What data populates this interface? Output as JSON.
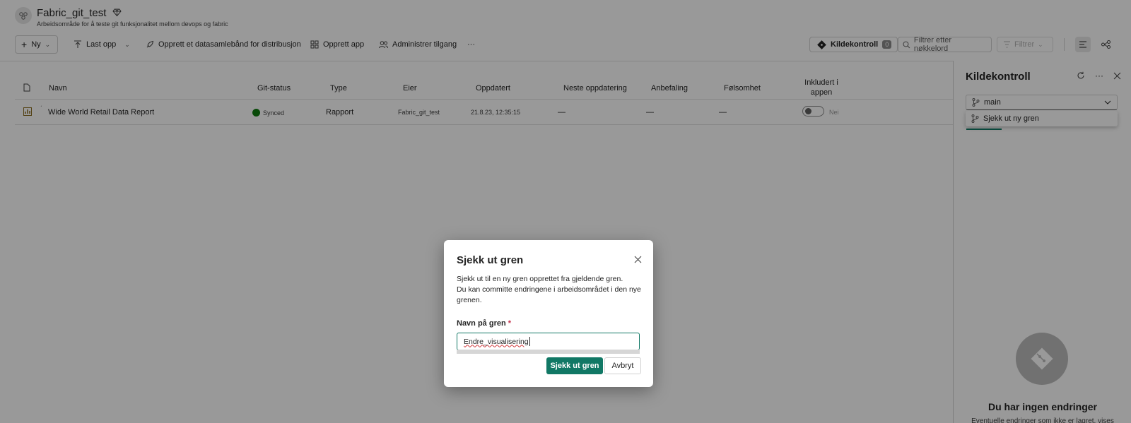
{
  "workspace": {
    "title": "Fabric_git_test",
    "subtitle": "Arbeidsområde for å teste git funksjonalitet mellom devops og fabric"
  },
  "toolbar": {
    "new_label": "Ny",
    "upload_label": "Last opp",
    "pipeline_label": "Opprett et datasamlebånd for distribusjon",
    "create_app_label": "Opprett app",
    "manage_access_label": "Administrer tilgang",
    "more_label": "···",
    "source_control_label": "Kildekontroll",
    "source_control_count": "0",
    "search_placeholder": "Filtrer etter nøkkelord",
    "filter_label": "Filtrer"
  },
  "table": {
    "headers": {
      "name": "Navn",
      "git_status": "Git-status",
      "type": "Type",
      "owner": "Eier",
      "updated": "Oppdatert",
      "next_update": "Neste oppdatering",
      "endorsement": "Anbefaling",
      "sensitivity": "Følsomhet",
      "included_1": "Inkludert i",
      "included_2": "appen"
    },
    "rows": [
      {
        "name": "Wide World Retail Data Report",
        "git_status": "Synced",
        "type": "Rapport",
        "owner": "Fabric_git_test",
        "updated": "21.8.23, 12:35:15",
        "next_update": "—",
        "endorsement": "—",
        "sensitivity": "—",
        "included": "Nei"
      }
    ]
  },
  "panel": {
    "title": "Kildekontroll",
    "branch": "main",
    "dropdown_option": "Sjekk ut ny gren",
    "empty_title": "Du har ingen endringer",
    "empty_subtitle": "Eventuelle endringer som ikke er lagret, vises"
  },
  "dialog": {
    "title": "Sjekk ut gren",
    "description_1": "Sjekk ut til en ny gren opprettet fra gjeldende gren.",
    "description_2": "Du kan committe endringene i arbeidsområdet i den nye grenen.",
    "field_label": "Navn på gren",
    "required_marker": "*",
    "field_value": "Endre_visualisering",
    "primary_button": "Sjekk ut gren",
    "secondary_button": "Avbryt"
  },
  "colors": {
    "accent": "#117865",
    "synced": "#107c10"
  }
}
